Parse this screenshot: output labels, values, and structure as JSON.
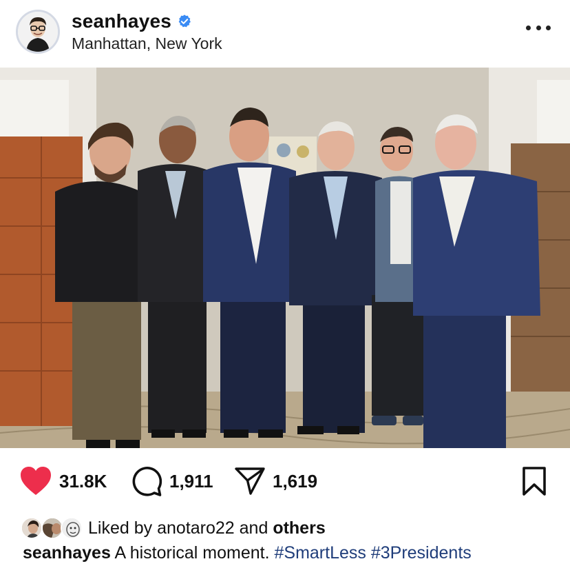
{
  "post": {
    "username": "seanhayes",
    "verified": true,
    "location": "Manhattan, New York",
    "icons": {
      "verified": "verified-badge-icon",
      "more": "more-options-icon",
      "like": "heart-filled-icon",
      "comment": "comment-bubble-icon",
      "share": "paper-plane-icon",
      "save": "bookmark-icon"
    },
    "colors": {
      "like": "#ed2e4c",
      "verified": "#3a8bf4",
      "hashtag": "#1f3d7a"
    }
  },
  "stats": {
    "likes": "31.8K",
    "comments": "1,911",
    "shares": "1,619"
  },
  "liked_by": {
    "prefix": "Liked by",
    "user": "anotaro22",
    "joiner": "and",
    "others": "others"
  },
  "caption": {
    "user": "seanhayes",
    "text": "A historical moment.",
    "hashtags": [
      "#SmartLess",
      "#3Presidents"
    ]
  }
}
